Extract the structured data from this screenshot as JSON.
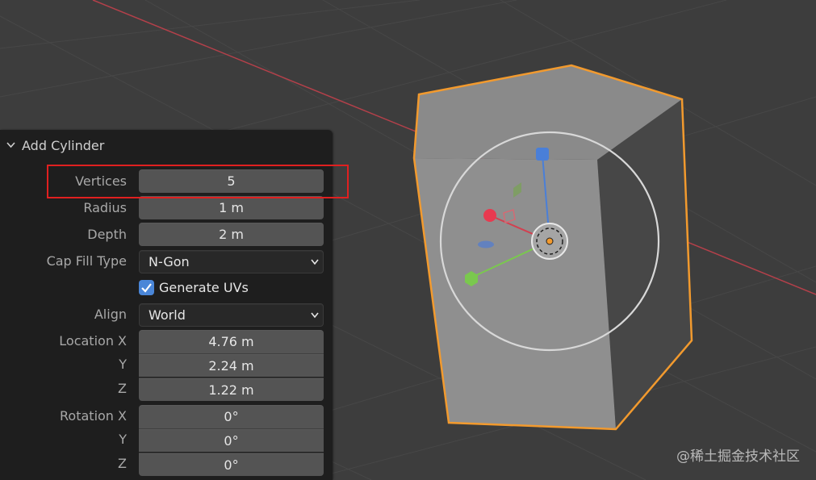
{
  "panel": {
    "title": "Add Cylinder",
    "rows": {
      "vertices": {
        "label": "Vertices",
        "value": "5"
      },
      "radius": {
        "label": "Radius",
        "value": "1 m"
      },
      "depth": {
        "label": "Depth",
        "value": "2 m"
      },
      "cap_fill_type": {
        "label": "Cap Fill Type",
        "value": "N-Gon"
      },
      "generate_uvs": {
        "label": "Generate UVs",
        "checked": true
      },
      "align": {
        "label": "Align",
        "value": "World"
      },
      "location": {
        "label": "Location X",
        "x": "4.76 m",
        "y_label": "Y",
        "y": "2.24 m",
        "z_label": "Z",
        "z": "1.22 m"
      },
      "rotation": {
        "label": "Rotation X",
        "x": "0°",
        "y_label": "Y",
        "y": "0°",
        "z_label": "Z",
        "z": "0°"
      }
    }
  },
  "watermark": "@稀土掘金技术社区",
  "colors": {
    "viewport_bg": "#3d3d3d",
    "panel_bg": "#1e1e1e",
    "field_bg": "#545454",
    "selection_outline": "#f29a2e",
    "highlight_box": "#e02020",
    "x_axis": "#b4404a",
    "checkbox": "#4a86d8"
  }
}
